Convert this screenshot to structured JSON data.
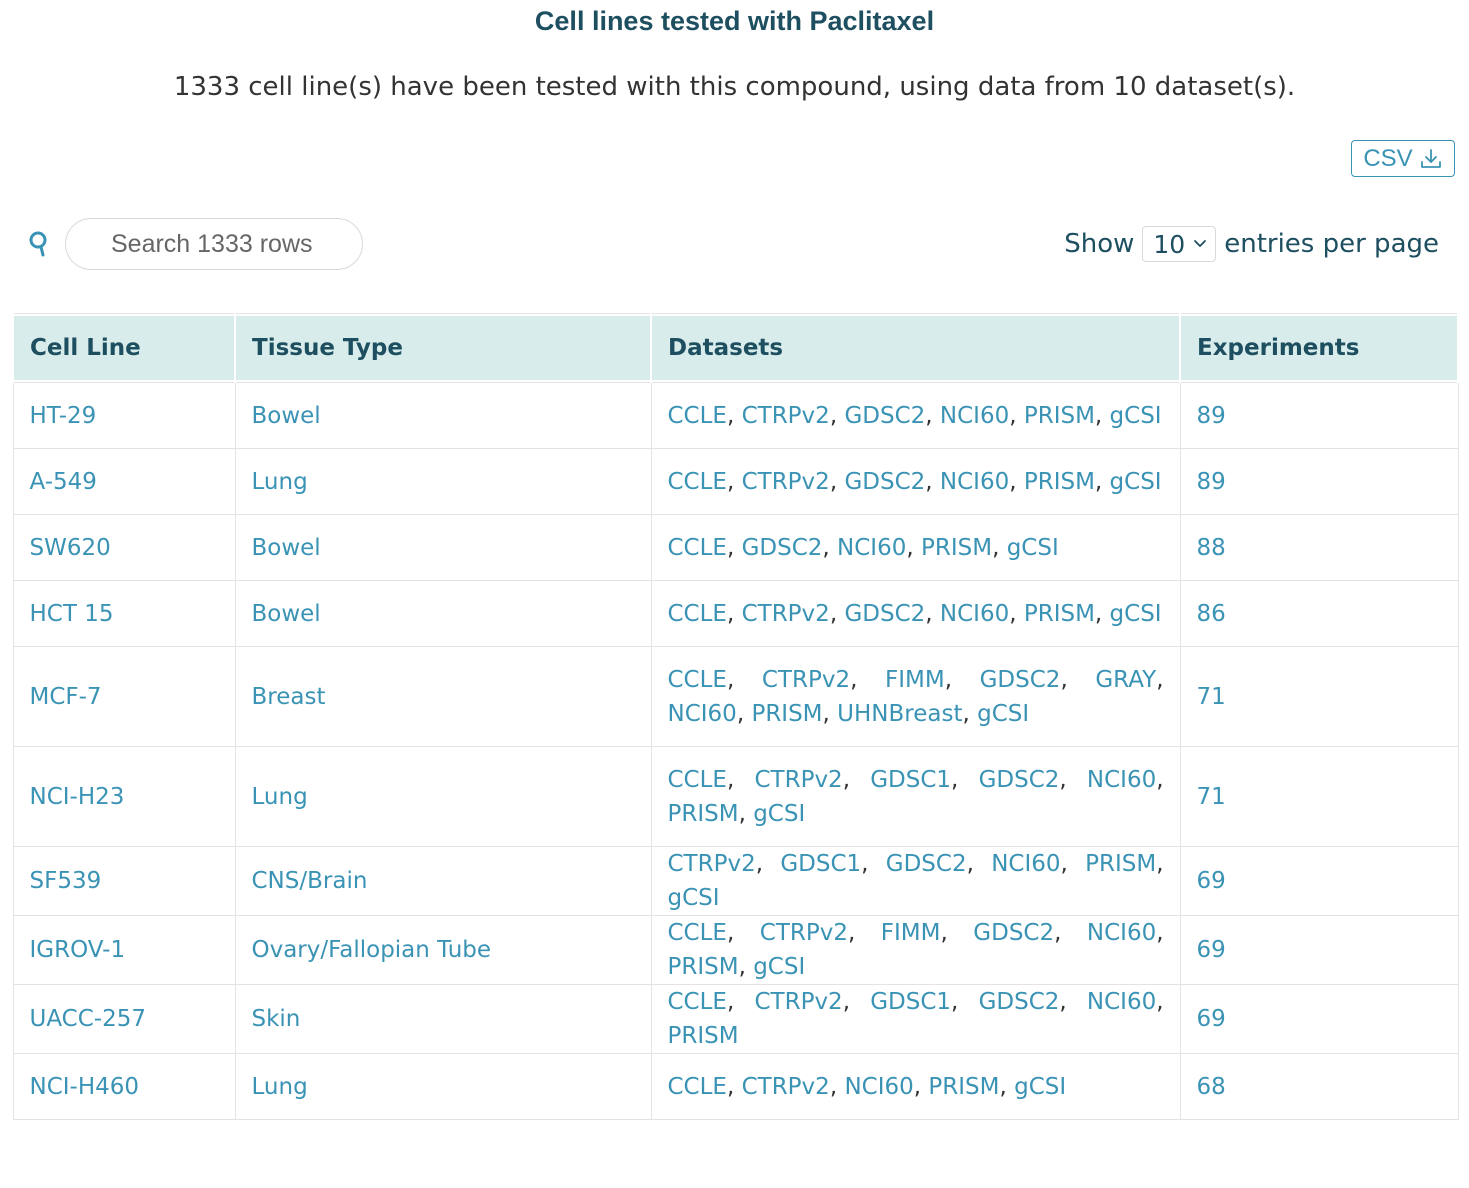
{
  "header": {
    "title": "Cell lines tested with Paclitaxel",
    "summary": "1333 cell line(s) have been tested with this compound, using data from 10 dataset(s)."
  },
  "toolbar": {
    "csv_label": "CSV",
    "search_placeholder": "Search 1333 rows",
    "show_label": "Show",
    "page_size": "10",
    "entries_label": "entries per page"
  },
  "colors": {
    "title": "#1d4f60",
    "link": "#3a93b5",
    "header_bg": "#d9ecec"
  },
  "table": {
    "columns": [
      "Cell Line",
      "Tissue Type",
      "Datasets",
      "Experiments"
    ],
    "rows": [
      {
        "cell_line": "HT-29",
        "tissue": "Bowel",
        "datasets": [
          "CCLE",
          "CTRPv2",
          "GDSC2",
          "NCI60",
          "PRISM",
          "gCSI"
        ],
        "experiments": "89"
      },
      {
        "cell_line": "A-549",
        "tissue": "Lung",
        "datasets": [
          "CCLE",
          "CTRPv2",
          "GDSC2",
          "NCI60",
          "PRISM",
          "gCSI"
        ],
        "experiments": "89"
      },
      {
        "cell_line": "SW620",
        "tissue": "Bowel",
        "datasets": [
          "CCLE",
          "GDSC2",
          "NCI60",
          "PRISM",
          "gCSI"
        ],
        "experiments": "88"
      },
      {
        "cell_line": "HCT 15",
        "tissue": "Bowel",
        "datasets": [
          "CCLE",
          "CTRPv2",
          "GDSC2",
          "NCI60",
          "PRISM",
          "gCSI"
        ],
        "experiments": "86"
      },
      {
        "cell_line": "MCF-7",
        "tissue": "Breast",
        "datasets": [
          "CCLE",
          "CTRPv2",
          "FIMM",
          "GDSC2",
          "GRAY",
          "NCI60",
          "PRISM",
          "UHNBreast",
          "gCSI"
        ],
        "experiments": "71"
      },
      {
        "cell_line": "NCI-H23",
        "tissue": "Lung",
        "datasets": [
          "CCLE",
          "CTRPv2",
          "GDSC1",
          "GDSC2",
          "NCI60",
          "PRISM",
          "gCSI"
        ],
        "experiments": "71"
      },
      {
        "cell_line": "SF539",
        "tissue": "CNS/Brain",
        "datasets": [
          "CTRPv2",
          "GDSC1",
          "GDSC2",
          "NCI60",
          "PRISM",
          "gCSI"
        ],
        "experiments": "69"
      },
      {
        "cell_line": "IGROV-1",
        "tissue": "Ovary/Fallopian Tube",
        "datasets": [
          "CCLE",
          "CTRPv2",
          "FIMM",
          "GDSC2",
          "NCI60",
          "PRISM",
          "gCSI"
        ],
        "experiments": "69"
      },
      {
        "cell_line": "UACC-257",
        "tissue": "Skin",
        "datasets": [
          "CCLE",
          "CTRPv2",
          "GDSC1",
          "GDSC2",
          "NCI60",
          "PRISM"
        ],
        "experiments": "69"
      },
      {
        "cell_line": "NCI-H460",
        "tissue": "Lung",
        "datasets": [
          "CCLE",
          "CTRPv2",
          "NCI60",
          "PRISM",
          "gCSI"
        ],
        "experiments": "68"
      }
    ]
  }
}
